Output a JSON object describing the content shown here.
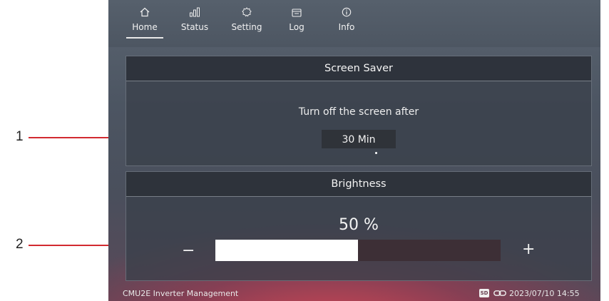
{
  "callouts": {
    "one": "1",
    "two": "2"
  },
  "nav": {
    "items": [
      {
        "label": "Home",
        "icon": "home-icon"
      },
      {
        "label": "Status",
        "icon": "status-icon"
      },
      {
        "label": "Setting",
        "icon": "gear-icon"
      },
      {
        "label": "Log",
        "icon": "log-icon"
      },
      {
        "label": "Info",
        "icon": "info-icon"
      }
    ],
    "active": "Home"
  },
  "screen_saver": {
    "title": "Screen Saver",
    "prompt": "Turn off the screen after",
    "value": "30 Min"
  },
  "brightness": {
    "title": "Brightness",
    "value_text": "50 %",
    "level": 0.5,
    "minus_label": "−",
    "plus_label": "+"
  },
  "footer": {
    "title": "CMU2E Inverter Management",
    "sd_label": "SD",
    "datetime": "2023/07/10 14:55"
  },
  "colors": {
    "callout_line": "#d22a30",
    "slider_fill": "#ffffff",
    "slider_track": "#3d2f36"
  }
}
